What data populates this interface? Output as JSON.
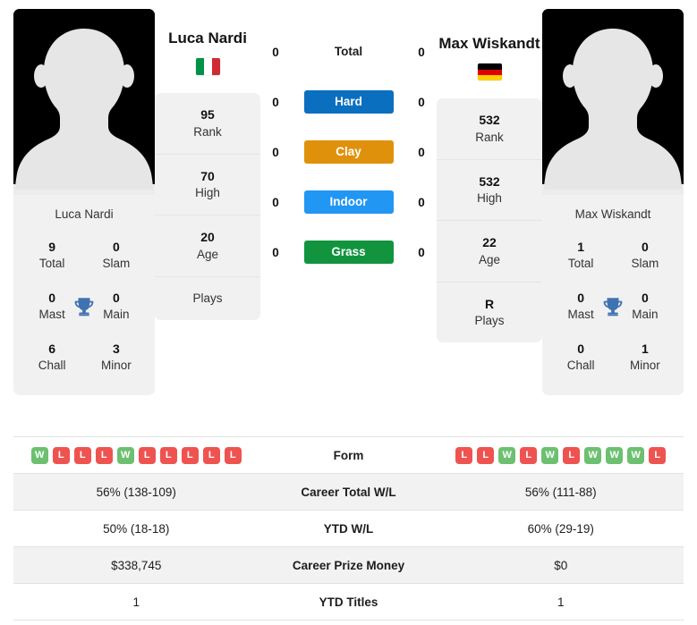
{
  "players": {
    "left": {
      "name": "Luca Nardi",
      "photo_caption": "Luca Nardi",
      "flag_name": "italy-flag",
      "flag_colors": [
        "#009246",
        "#ffffff",
        "#ce2b37"
      ],
      "flag_orientation": "vertical",
      "rank": "95",
      "rank_label": "Rank",
      "high": "70",
      "high_label": "High",
      "age": "20",
      "age_label": "Age",
      "plays": "",
      "plays_label": "Plays",
      "titles": {
        "total": "9",
        "total_label": "Total",
        "slam": "0",
        "slam_label": "Slam",
        "mast": "0",
        "mast_label": "Mast",
        "main": "0",
        "main_label": "Main",
        "chall": "6",
        "chall_label": "Chall",
        "minor": "3",
        "minor_label": "Minor"
      },
      "form": [
        "W",
        "L",
        "L",
        "L",
        "W",
        "L",
        "L",
        "L",
        "L",
        "L"
      ],
      "career_wl": "56% (138-109)",
      "ytd_wl": "50% (18-18)",
      "prize_money": "$338,745",
      "ytd_titles": "1",
      "surface_scores": {
        "total": "0",
        "hard": "0",
        "clay": "0",
        "indoor": "0",
        "grass": "0"
      }
    },
    "right": {
      "name": "Max Wiskandt",
      "photo_caption": "Max Wiskandt",
      "flag_name": "germany-flag",
      "flag_colors": [
        "#000000",
        "#dd0000",
        "#ffce00"
      ],
      "flag_orientation": "horizontal",
      "rank": "532",
      "rank_label": "Rank",
      "high": "532",
      "high_label": "High",
      "age": "22",
      "age_label": "Age",
      "plays": "R",
      "plays_label": "Plays",
      "titles": {
        "total": "1",
        "total_label": "Total",
        "slam": "0",
        "slam_label": "Slam",
        "mast": "0",
        "mast_label": "Mast",
        "main": "0",
        "main_label": "Main",
        "chall": "0",
        "chall_label": "Chall",
        "minor": "1",
        "minor_label": "Minor"
      },
      "form": [
        "L",
        "L",
        "W",
        "L",
        "W",
        "L",
        "W",
        "W",
        "W",
        "L"
      ],
      "career_wl": "56% (111-88)",
      "ytd_wl": "60% (29-19)",
      "prize_money": "$0",
      "ytd_titles": "1",
      "surface_scores": {
        "total": "0",
        "hard": "0",
        "clay": "0",
        "indoor": "0",
        "grass": "0"
      }
    }
  },
  "surfaces": [
    {
      "key": "total",
      "label": "Total",
      "color": "",
      "has_bar": false
    },
    {
      "key": "hard",
      "label": "Hard",
      "color": "#0b6fc0",
      "has_bar": true
    },
    {
      "key": "clay",
      "label": "Clay",
      "color": "#e0910b",
      "has_bar": true
    },
    {
      "key": "indoor",
      "label": "Indoor",
      "color": "#2196f3",
      "has_bar": true
    },
    {
      "key": "grass",
      "label": "Grass",
      "color": "#12943f",
      "has_bar": true
    }
  ],
  "table_rows": [
    {
      "label": "Form",
      "type": "form"
    },
    {
      "label": "Career Total W/L",
      "type": "text",
      "key": "career_wl"
    },
    {
      "label": "YTD W/L",
      "type": "text",
      "key": "ytd_wl"
    },
    {
      "label": "Career Prize Money",
      "type": "text",
      "key": "prize_money"
    },
    {
      "label": "YTD Titles",
      "type": "text",
      "key": "ytd_titles"
    }
  ],
  "colors": {
    "win_badge": "#6cc070",
    "loss_badge": "#ef5350",
    "trophy": "#3f72b0",
    "card_bg": "#f1f1f1",
    "row_alt_bg": "#f2f2f2"
  },
  "icons": {
    "trophy": "trophy-icon",
    "avatar": "avatar-silhouette-icon"
  }
}
